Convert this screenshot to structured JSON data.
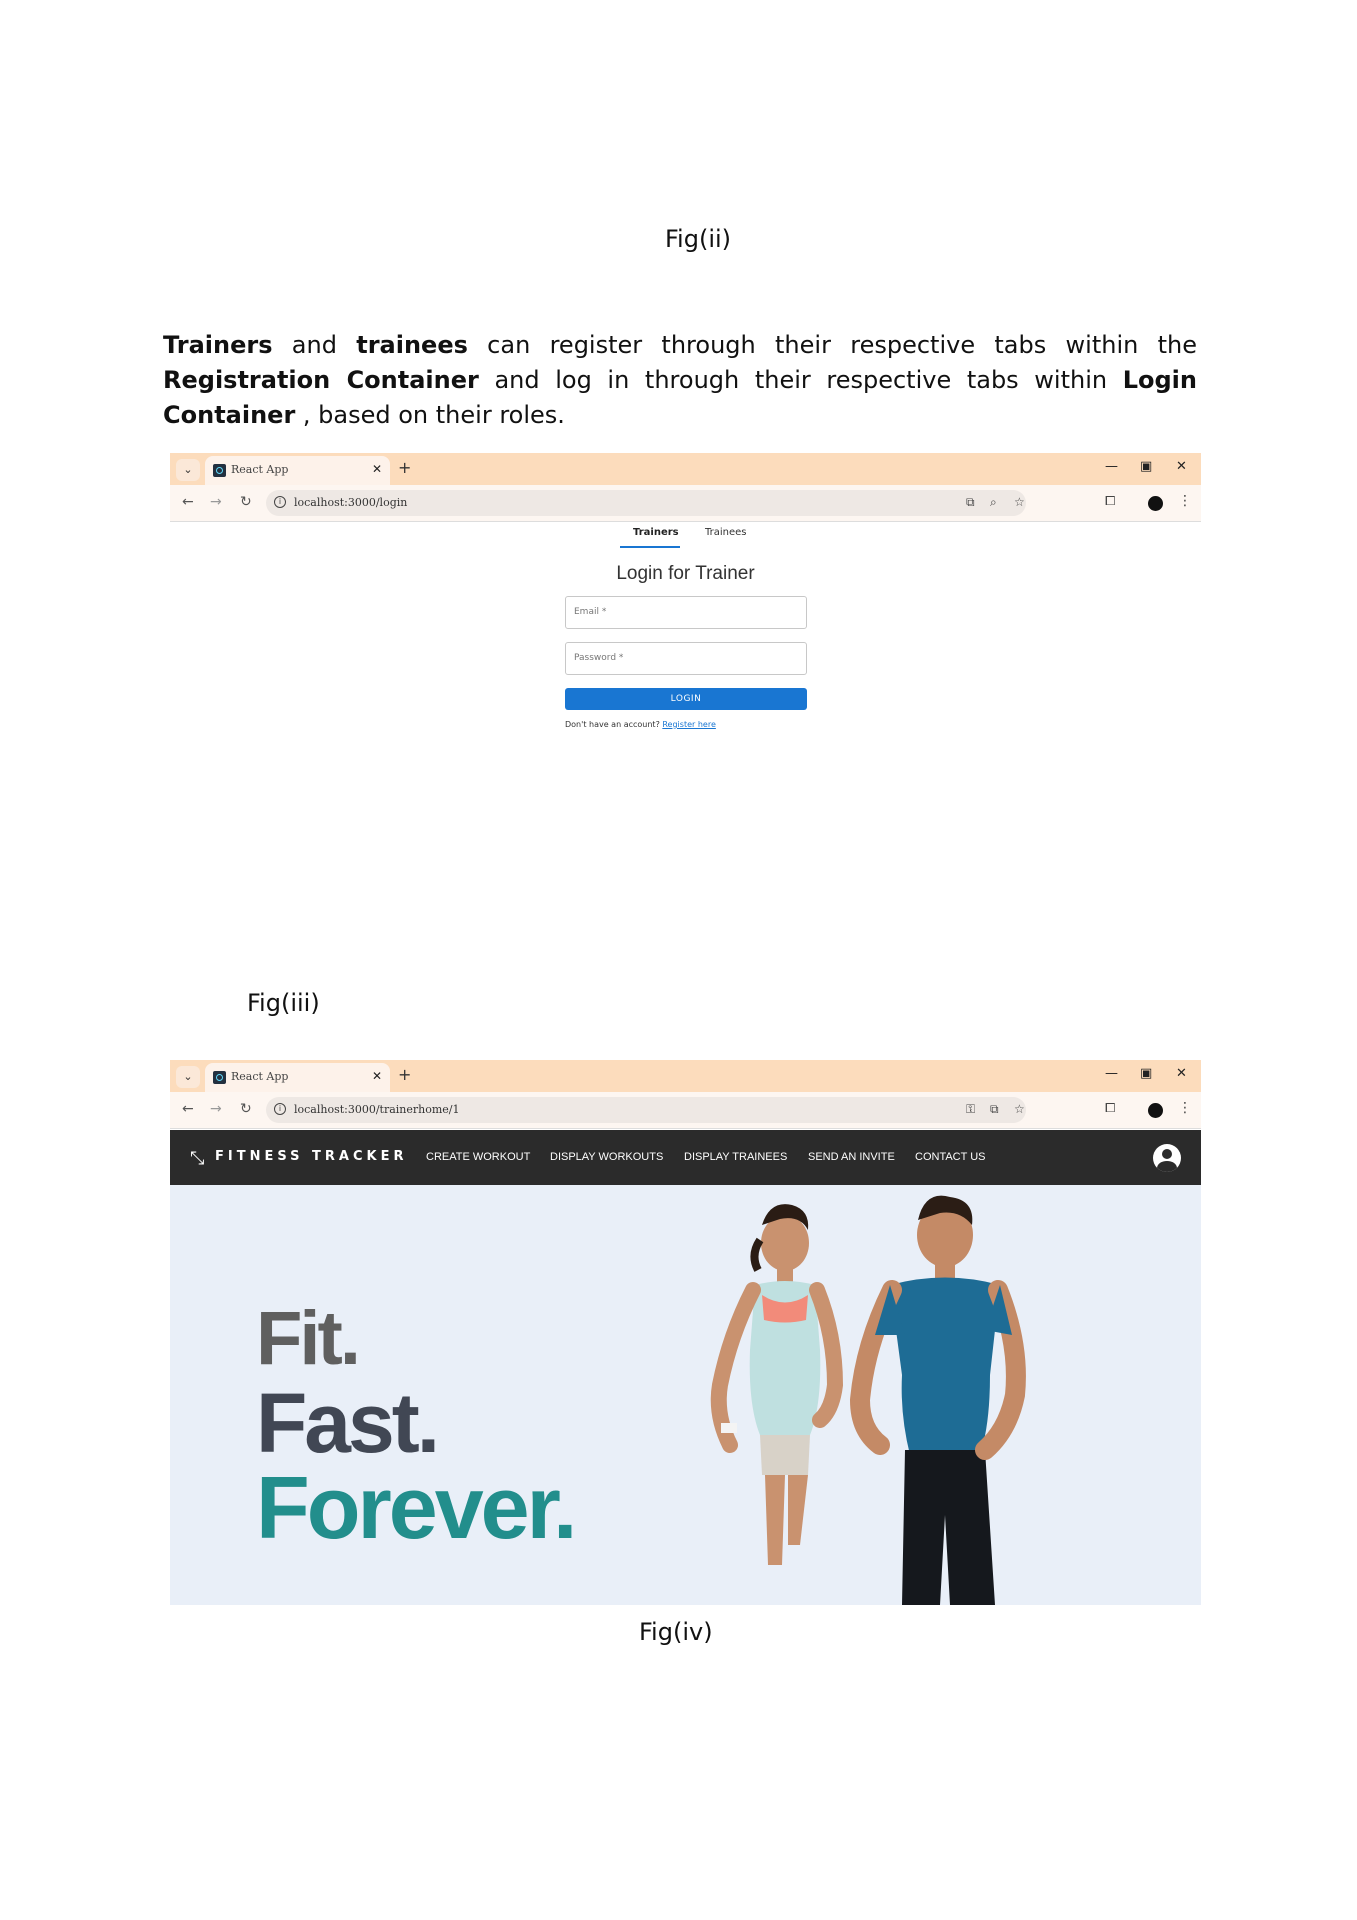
{
  "captions": {
    "fig2": "Fig(ii)",
    "fig3": "Fig(iii)",
    "fig4": "Fig(iv)"
  },
  "paragraph": {
    "b1": "Trainers",
    "t1": " and ",
    "b2": "trainees",
    "t2": " can register through their respective tabs within the ",
    "b3": "Registration Container",
    "t3": " and log in through their respective tabs within ",
    "b4": "Login Container",
    "t4": " , based on their roles."
  },
  "browser1": {
    "tab_title": "React App",
    "url": "localhost:3000/login"
  },
  "login": {
    "tabs": [
      "Trainers",
      "Trainees"
    ],
    "title": "Login for Trainer",
    "email_label": "Email *",
    "password_label": "Password *",
    "button": "LOGIN",
    "footer_text": "Don't have an account? ",
    "register_link": "Register here"
  },
  "browser2": {
    "tab_title": "React App",
    "url": "localhost:3000/trainerhome/1"
  },
  "trainer_home": {
    "brand": "FITNESS TRACKER",
    "nav": [
      "CREATE WORKOUT",
      "DISPLAY WORKOUTS",
      "DISPLAY TRAINEES",
      "SEND AN INVITE",
      "CONTACT US"
    ],
    "slogan": [
      "Fit.",
      "Fast.",
      "Forever."
    ]
  },
  "colors": {
    "tabstrip": "#fcdcbc",
    "primary_button": "#1976d2",
    "navbar": "#2b2b2b",
    "hero_bg": "#e9eff8",
    "slogan_accent": "#228e8c"
  },
  "icons": [
    "chevron-down-icon",
    "react-favicon-icon",
    "close-icon",
    "plus-icon",
    "minimize-icon",
    "restore-icon",
    "back-icon",
    "forward-icon",
    "reload-icon",
    "info-icon",
    "cast-icon",
    "zoom-icon",
    "star-icon",
    "key-icon",
    "extensions-icon",
    "profile-icon",
    "menu-dots-icon",
    "logo-icon",
    "account-icon"
  ]
}
